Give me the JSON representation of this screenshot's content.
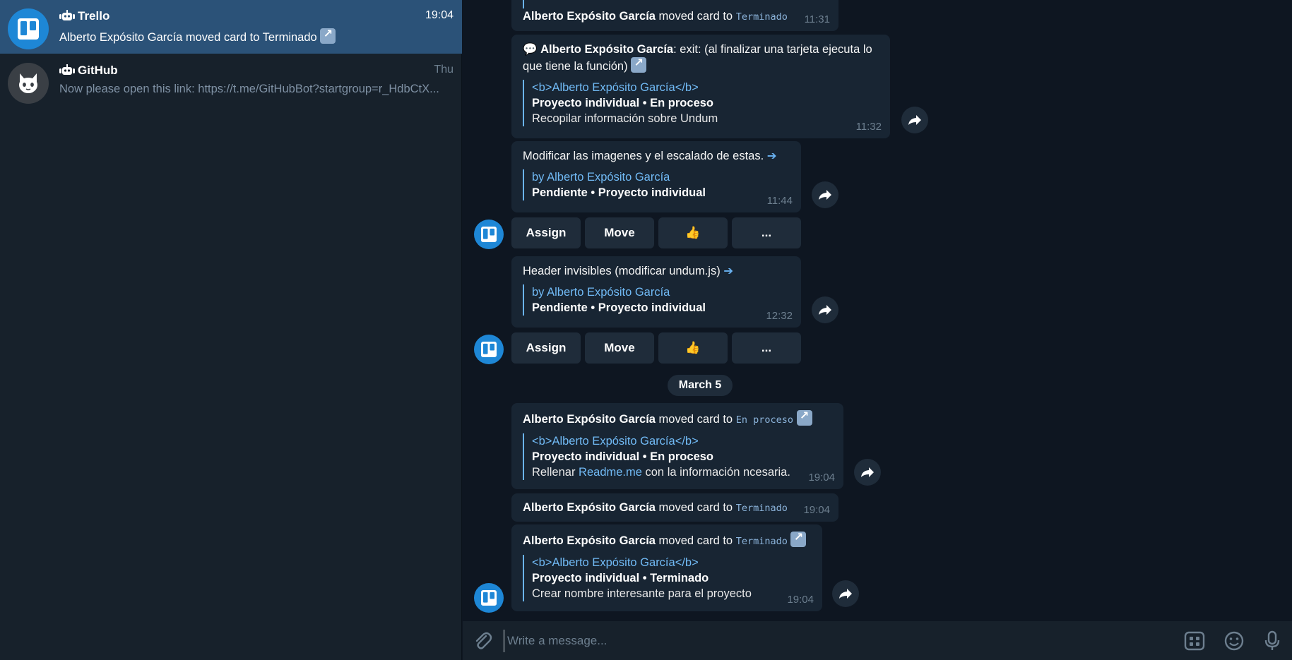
{
  "sidebar": {
    "chats": [
      {
        "name": "Trello",
        "time": "19:04",
        "preview": "Alberto Expósito García moved card to Terminado",
        "icon": "trello-logo-icon",
        "active": true
      },
      {
        "name": "GitHub",
        "time": "Thu",
        "preview": "Now please open this link: https://t.me/GitHubBot?startgroup=r_HdbCtX...",
        "icon": "github-octocat-icon",
        "active": false
      }
    ]
  },
  "messages": {
    "m0": {
      "author": "Alberto Expósito García",
      "text": " moved card to ",
      "code": "Terminado",
      "time": "11:31"
    },
    "m1": {
      "emoji": "💬",
      "author": "Alberto Expósito García",
      "text": ": exit: (al finalizar una tarjeta ejecuta lo que tiene la función)",
      "q1": "<b>Alberto Expósito García</b>",
      "q2": "Proyecto individual • En proceso",
      "q3": "Recopilar información sobre Undum",
      "time": "11:32"
    },
    "m2": {
      "text": "Modificar las imagenes y el escalado de estas.",
      "arrow": "➔",
      "q1": "by Alberto Expósito García",
      "q2": "Pendiente • Proyecto individual",
      "time": "11:44"
    },
    "m3": {
      "text": "Header invisibles (modificar undum.js)",
      "arrow": "➔",
      "q1": "by Alberto Expósito García",
      "q2": "Pendiente • Proyecto individual",
      "time": "12:32"
    },
    "m4": {
      "author": "Alberto Expósito García",
      "text": " moved card to ",
      "code": "En proceso",
      "q1": "<b>Alberto Expósito García</b>",
      "q2": "Proyecto individual • En proceso",
      "q3a": "Rellenar ",
      "q3link": "Readme.me",
      "q3b": " con la información ncesaria.",
      "time": "19:04"
    },
    "m5": {
      "author": "Alberto Expósito García",
      "text": " moved card to ",
      "code": "Terminado",
      "time": "19:04"
    },
    "m6": {
      "author": "Alberto Expósito García",
      "text": " moved card to ",
      "code": "Terminado",
      "q1": "<b>Alberto Expósito García</b>",
      "q2": "Proyecto individual • Terminado",
      "q3": "Crear nombre interesante para el proyecto",
      "time": "19:04"
    }
  },
  "keyboard": {
    "assign": "Assign",
    "move": "Move",
    "like": "👍",
    "more": "..."
  },
  "date_separator": "March 5",
  "composer": {
    "placeholder": "Write a message..."
  },
  "colors": {
    "sidebar_bg": "#17212b",
    "chat_bg": "#0e1621",
    "active_chat": "#2b5278",
    "bubble": "#182533",
    "accent": "#6ab3f3",
    "trello_blue": "#1e87d6"
  }
}
